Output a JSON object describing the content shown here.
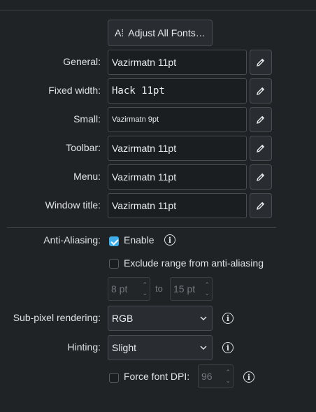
{
  "toolbar": {
    "adjust_all_label": "Adjust All Fonts…",
    "adjust_icon": "font-size-icon"
  },
  "fonts": {
    "general": {
      "label": "General:",
      "value": "Vazirmatn 11pt"
    },
    "fixed_width": {
      "label": "Fixed width:",
      "value": "Hack 11pt"
    },
    "small": {
      "label": "Small:",
      "value": "Vazirmatn 9pt"
    },
    "toolbar": {
      "label": "Toolbar:",
      "value": "Vazirmatn 11pt"
    },
    "menu": {
      "label": "Menu:",
      "value": "Vazirmatn 11pt"
    },
    "window_title": {
      "label": "Window title:",
      "value": "Vazirmatn 11pt"
    }
  },
  "anti_aliasing": {
    "label": "Anti-Aliasing:",
    "enable_label": "Enable",
    "enable_checked": true,
    "exclude_label": "Exclude range from anti-aliasing",
    "exclude_checked": false,
    "range_from": "8 pt",
    "range_to_label": "to",
    "range_to": "15 pt"
  },
  "subpixel": {
    "label": "Sub-pixel rendering:",
    "value": "RGB"
  },
  "hinting": {
    "label": "Hinting:",
    "value": "Slight"
  },
  "dpi": {
    "label": "Force font DPI:",
    "checked": false,
    "value": "96"
  },
  "colors": {
    "background": "#202326",
    "accent": "#3daee9"
  }
}
